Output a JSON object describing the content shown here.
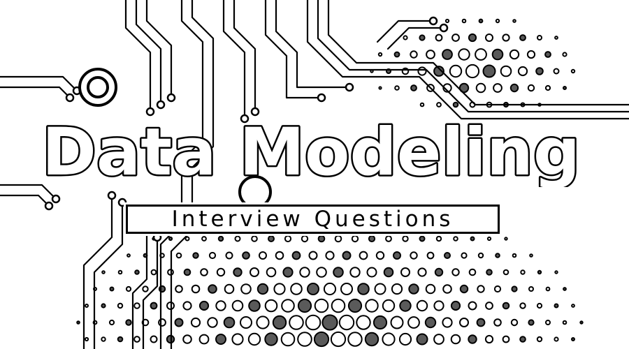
{
  "banner": {
    "title": "Data Modeling",
    "subtitle": "Interview Questions"
  },
  "colors": {
    "ink": "#000000",
    "paper": "#ffffff",
    "halftone": "#5a5a5a"
  },
  "art": {
    "background": "circuit-board-halftone"
  }
}
